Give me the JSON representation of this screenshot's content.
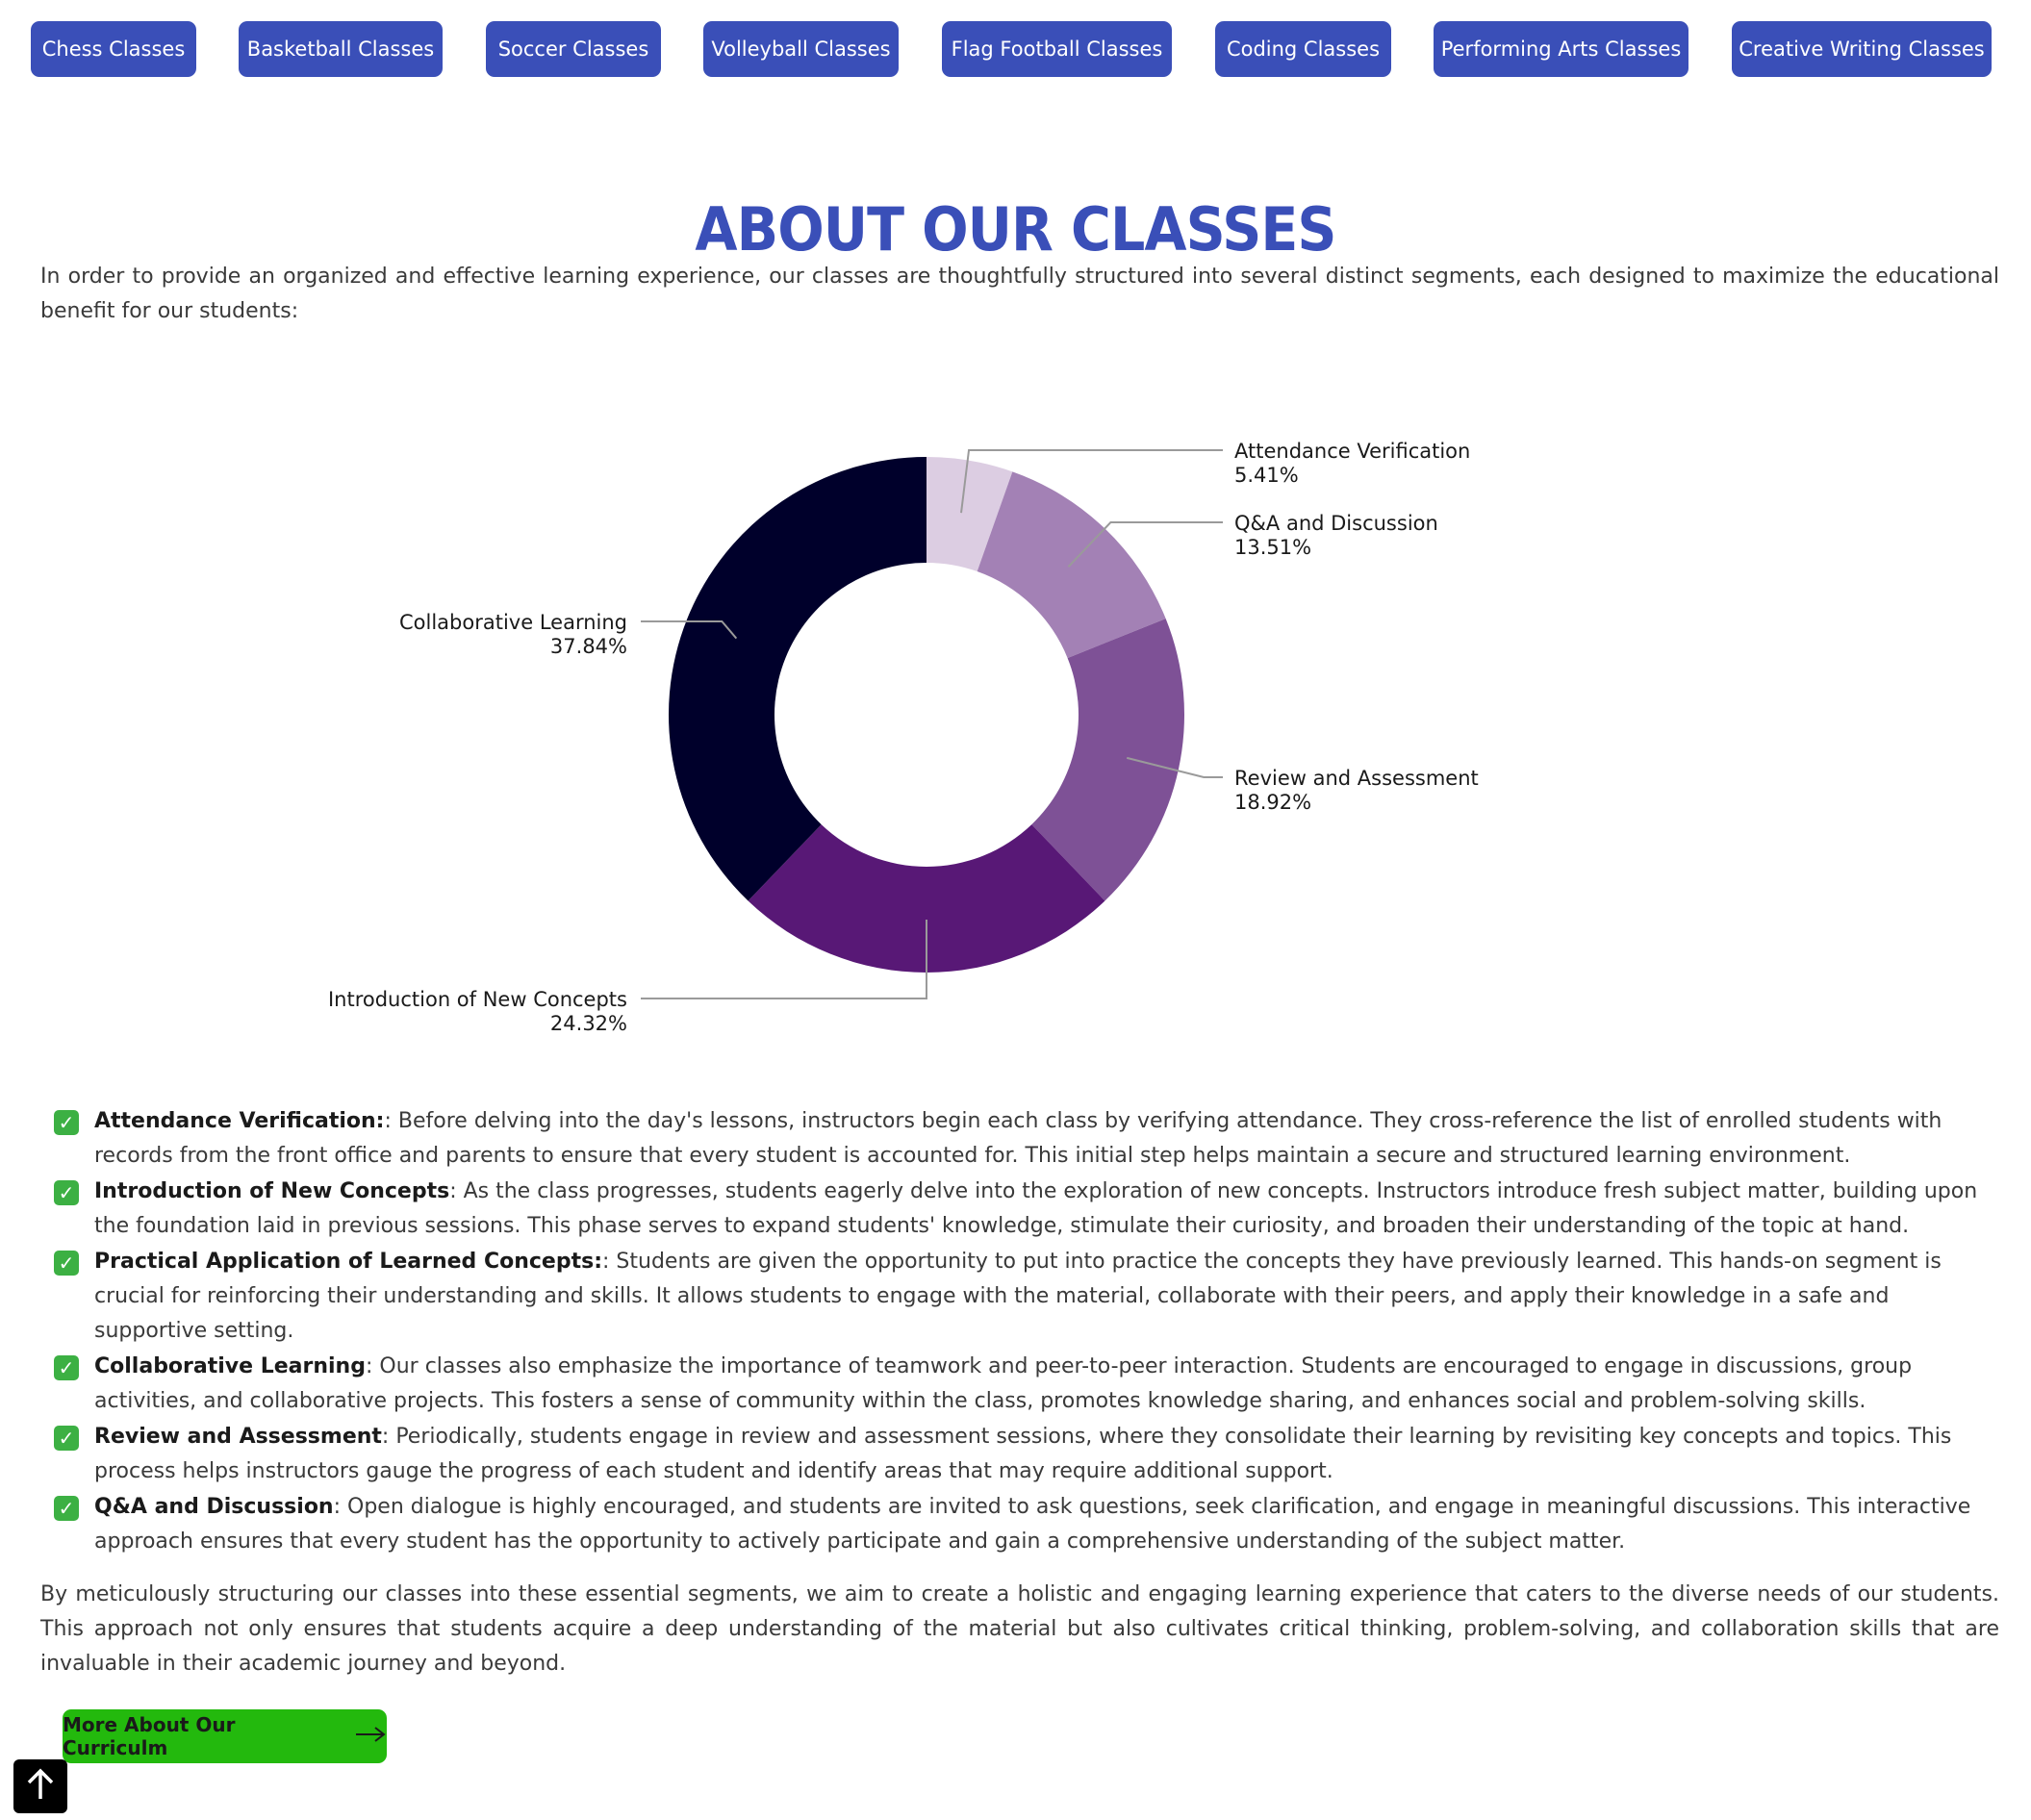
{
  "nav": [
    {
      "label": "Chess Classes"
    },
    {
      "label": "Basketball Classes"
    },
    {
      "label": "Soccer Classes"
    },
    {
      "label": "Volleyball Classes"
    },
    {
      "label": "Flag Football Classes"
    },
    {
      "label": "Coding Classes"
    },
    {
      "label": "Performing Arts Classes"
    },
    {
      "label": "Creative Writing Classes"
    }
  ],
  "title": "About Our Classes",
  "intro": "In order to provide an organized and effective learning experience, our classes are thoughtfully structured into several distinct segments, each designed to maximize the educational benefit for our students:",
  "chart_data": {
    "type": "pie",
    "categories": [
      "Attendance Verification",
      "Q&A and Discussion",
      "Review and Assessment",
      "Introduction of New Concepts",
      "Collaborative Learning"
    ],
    "values": [
      5.41,
      13.51,
      18.92,
      24.32,
      37.84
    ],
    "value_labels": [
      "5.41%",
      "13.51%",
      "18.92%",
      "24.32%",
      "37.84%"
    ],
    "colors": [
      "#dccde2",
      "#a381b5",
      "#7e5196",
      "#581876",
      "#00002b"
    ],
    "donut": true
  },
  "items": [
    {
      "title": "Attendance Verification:",
      "text": ": Before delving into the day's lessons, instructors begin each class by verifying attendance. They cross-reference the list of enrolled students with records from the front office and parents to ensure that every student is accounted for. This initial step helps maintain a secure and structured learning environment."
    },
    {
      "title": "Introduction of New Concepts",
      "text": ": As the class progresses, students eagerly delve into the exploration of new concepts. Instructors introduce fresh subject matter, building upon the foundation laid in previous sessions. This phase serves to expand students' knowledge, stimulate their curiosity, and broaden their understanding of the topic at hand."
    },
    {
      "title": "Practical Application of Learned Concepts:",
      "text": ": Students are given the opportunity to put into practice the concepts they have previously learned. This hands-on segment is crucial for reinforcing their understanding and skills. It allows students to engage with the material, collaborate with their peers, and apply their knowledge in a safe and supportive setting."
    },
    {
      "title": "Collaborative Learning",
      "text": ": Our classes also emphasize the importance of teamwork and peer-to-peer interaction. Students are encouraged to engage in discussions, group activities, and collaborative projects. This fosters a sense of community within the class, promotes knowledge sharing, and enhances social and problem-solving skills."
    },
    {
      "title": "Review and Assessment",
      "text": ": Periodically, students engage in review and assessment sessions, where they consolidate their learning by revisiting key concepts and topics. This process helps instructors gauge the progress of each student and identify areas that may require additional support."
    },
    {
      "title": "Q&A and Discussion",
      "text": ": Open dialogue is highly encouraged, and students are invited to ask questions, seek clarification, and engage in meaningful discussions. This interactive approach ensures that every student has the opportunity to actively participate and gain a comprehensive understanding of the subject matter."
    }
  ],
  "check_glyph": "✓",
  "outro": "By meticulously structuring our classes into these essential segments, we aim to create a holistic and engaging learning experience that caters to the diverse needs of our students. This approach not only ensures that students acquire a deep understanding of the material but also cultivates critical thinking, problem-solving, and collaboration skills that are invaluable in their academic journey and beyond.",
  "cta": {
    "label": "More About Our Curriculm",
    "icon": "arrow-right-icon"
  },
  "back_to_top": {
    "icon": "arrow-up-icon"
  },
  "colors": {
    "brand_blue": "#3a4fb8",
    "cta_green": "#23b90d",
    "check_green": "#3cb043"
  }
}
